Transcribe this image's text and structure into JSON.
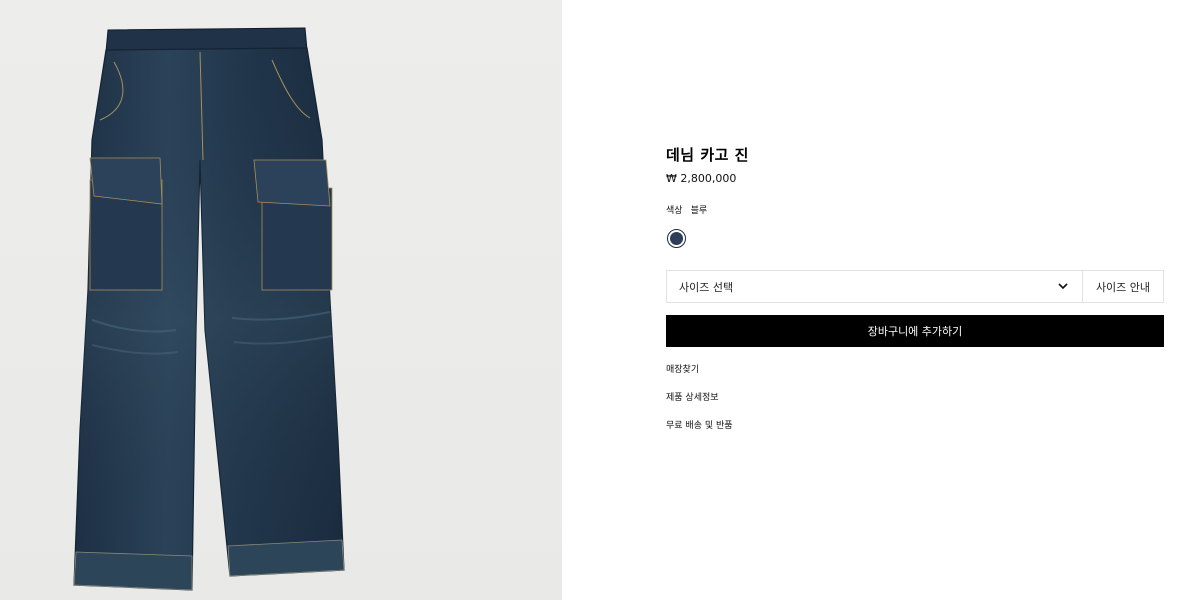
{
  "product": {
    "title": "데님 카고 진",
    "price": "₩ 2,800,000",
    "color_label": "색상",
    "color_value": "블루",
    "swatch_color": "#2c3e5a",
    "image_subject": "dark-blue-denim-cargo-jeans"
  },
  "size": {
    "select_label": "사이즈 선택",
    "guide_label": "사이즈 안내"
  },
  "cart": {
    "add_label": "장바구니에 추가하기"
  },
  "links": {
    "store_finder": "매장찾기",
    "product_details": "제품 상세정보",
    "shipping_returns": "무료 배송 및 반품"
  },
  "colors": {
    "image_background": "#ececea",
    "denim": "#22354a",
    "button_background": "#000000"
  }
}
